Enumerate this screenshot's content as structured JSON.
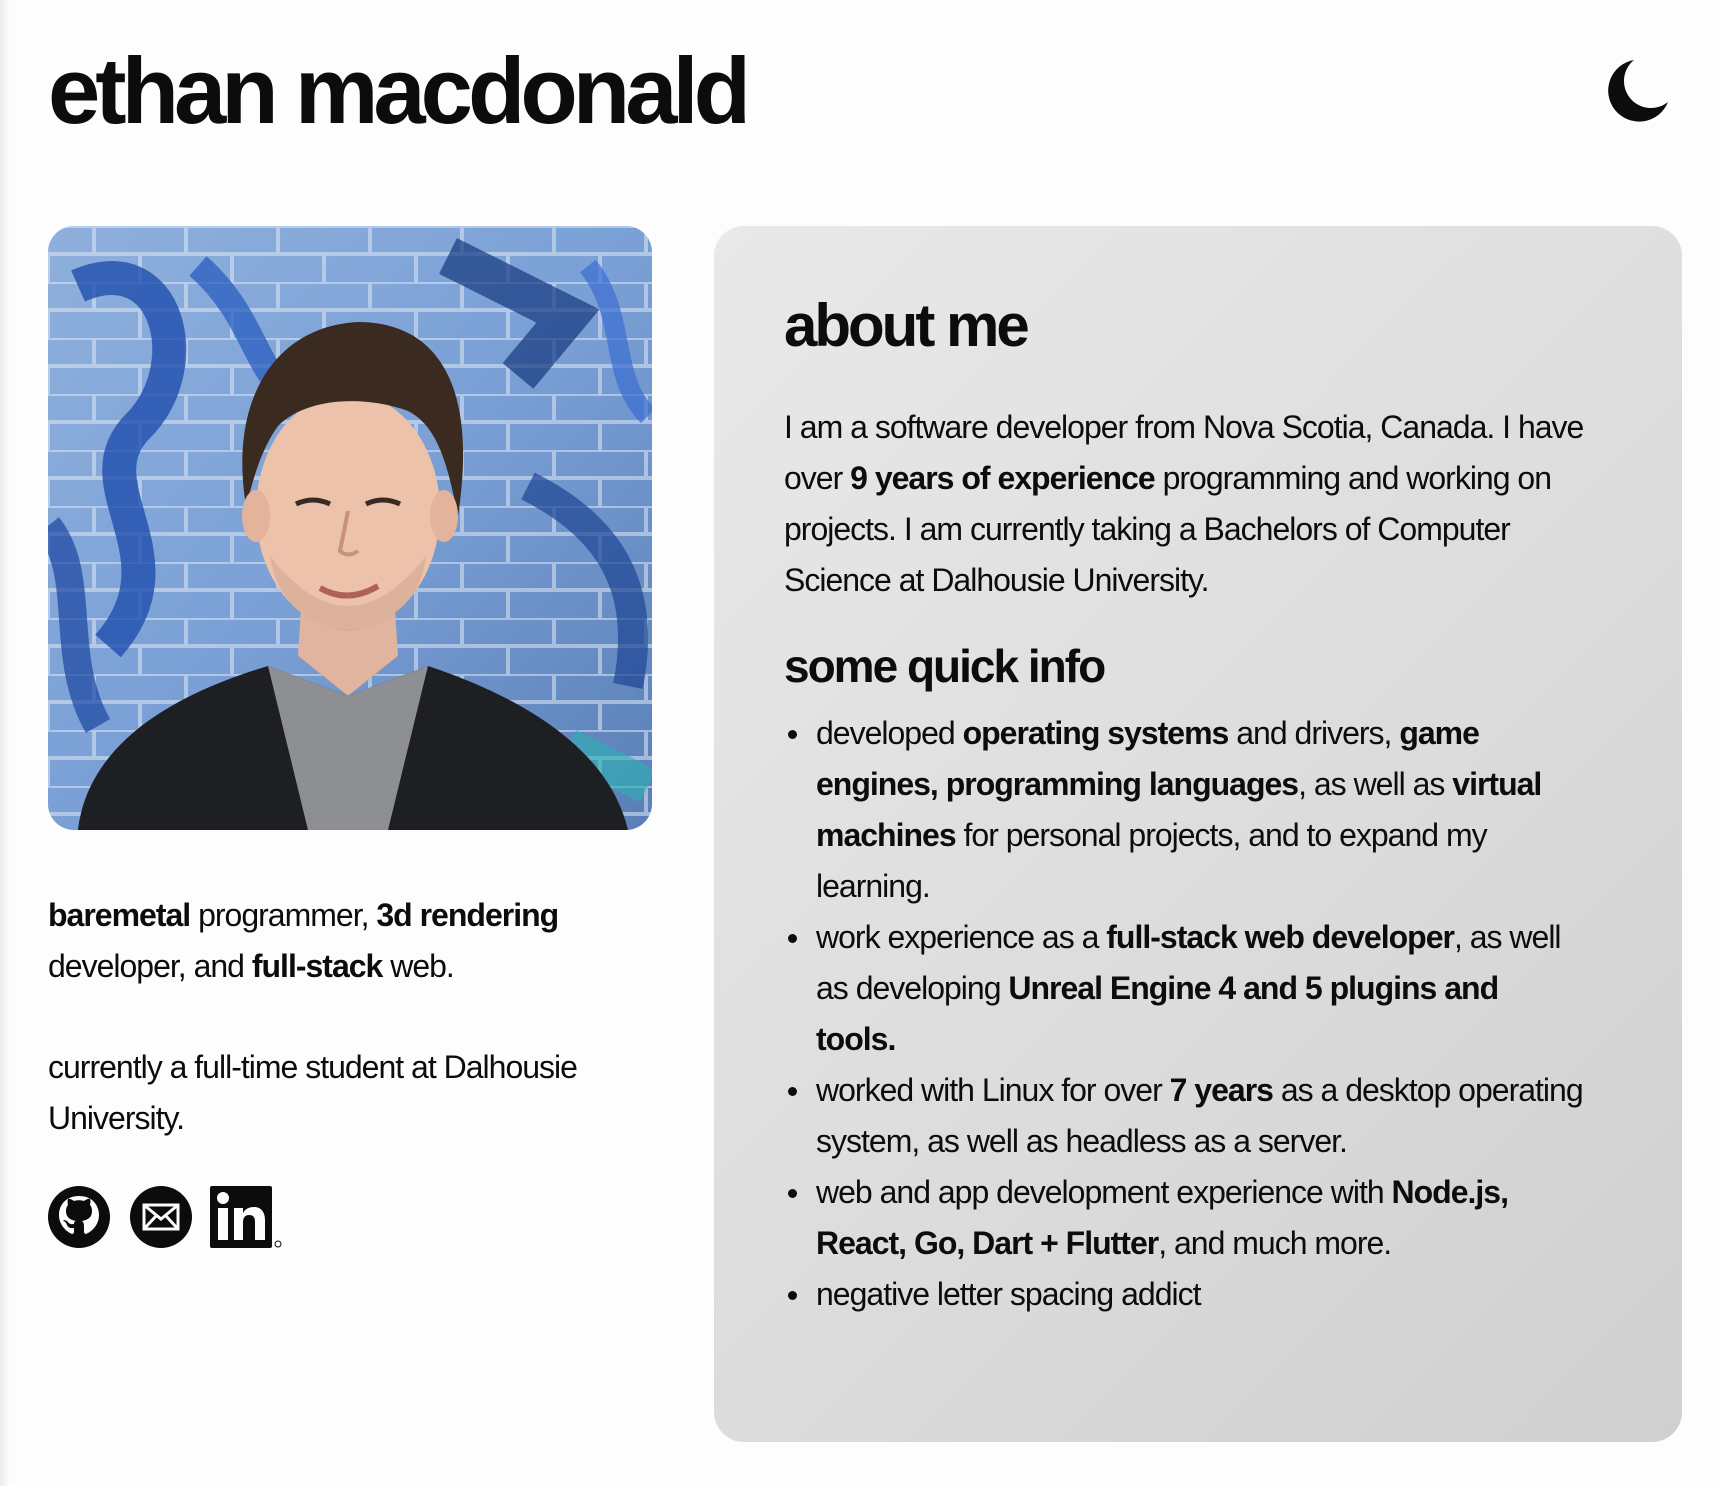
{
  "header": {
    "title": "ethan macdonald",
    "theme_toggle_icon": "moon-icon"
  },
  "profile": {
    "photo_alt": "photo",
    "tagline": [
      {
        "t": "baremetal",
        "b": true
      },
      {
        "t": " programmer, ",
        "b": false
      },
      {
        "t": "3d rendering",
        "b": true
      },
      {
        "t": " developer, and ",
        "b": false
      },
      {
        "t": "full-stack",
        "b": true
      },
      {
        "t": " web.",
        "b": false
      }
    ],
    "status": "currently a full-time student at Dalhousie University.",
    "socials": [
      {
        "name": "github-icon"
      },
      {
        "name": "email-icon"
      },
      {
        "name": "linkedin-icon"
      }
    ]
  },
  "about": {
    "title": "about me",
    "body": [
      {
        "t": "I am a software developer from Nova Scotia, Canada. I have over ",
        "b": false
      },
      {
        "t": "9 years of experience",
        "b": true
      },
      {
        "t": " programming and working on projects. I am currently taking a Bachelors of Computer Science at Dalhousie University.",
        "b": false
      }
    ],
    "quick_title": "some quick info",
    "quick_items": [
      [
        {
          "t": "developed ",
          "b": false
        },
        {
          "t": "operating systems",
          "b": true
        },
        {
          "t": " and drivers, ",
          "b": false
        },
        {
          "t": "game engines, programming languages",
          "b": true
        },
        {
          "t": ", as well as ",
          "b": false
        },
        {
          "t": "virtual machines",
          "b": true
        },
        {
          "t": " for personal projects, and to expand my learning.",
          "b": false
        }
      ],
      [
        {
          "t": "work experience as a ",
          "b": false
        },
        {
          "t": "full-stack web developer",
          "b": true
        },
        {
          "t": ", as well as developing ",
          "b": false
        },
        {
          "t": "Unreal Engine 4 and 5 plugins and tools.",
          "b": true
        }
      ],
      [
        {
          "t": "worked with Linux for over ",
          "b": false
        },
        {
          "t": "7 years",
          "b": true
        },
        {
          "t": " as a desktop operating system, as well as headless as a server.",
          "b": false
        }
      ],
      [
        {
          "t": "web and app development experience with ",
          "b": false
        },
        {
          "t": "Node.js, React, Go, Dart + Flutter",
          "b": true
        },
        {
          "t": ", and much more.",
          "b": false
        }
      ],
      [
        {
          "t": "negative letter spacing addict",
          "b": false
        }
      ]
    ]
  },
  "colors": {
    "text": "#0c0c0c",
    "background": "#fdfdfd",
    "card_start": "#e9e9e9",
    "card_end": "#cfcfcf"
  }
}
